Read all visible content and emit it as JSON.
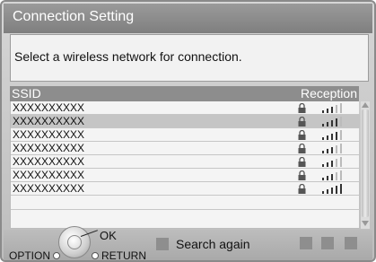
{
  "dialog": {
    "title": "Connection Setting",
    "message": "Select a wireless network for connection."
  },
  "list": {
    "columns": {
      "ssid": "SSID",
      "reception": "Reception"
    },
    "rows": [
      {
        "ssid": "XXXXXXXXXX",
        "locked": true,
        "signal_bars": 3,
        "selected": false
      },
      {
        "ssid": "XXXXXXXXXX",
        "locked": true,
        "signal_bars": 4,
        "selected": true
      },
      {
        "ssid": "XXXXXXXXXX",
        "locked": true,
        "signal_bars": 4,
        "selected": false
      },
      {
        "ssid": "XXXXXXXXXX",
        "locked": true,
        "signal_bars": 3,
        "selected": false
      },
      {
        "ssid": "XXXXXXXXXX",
        "locked": true,
        "signal_bars": 3,
        "selected": false
      },
      {
        "ssid": "XXXXXXXXXX",
        "locked": true,
        "signal_bars": 3,
        "selected": false
      },
      {
        "ssid": "XXXXXXXXXX",
        "locked": true,
        "signal_bars": 5,
        "selected": false
      }
    ]
  },
  "footer": {
    "ok_label": "OK",
    "option_label": "OPTION",
    "return_label": "RETURN",
    "search_again_label": "Search again"
  },
  "colors": {
    "title_bar": "#8b8b8b",
    "header_bar": "#8d8d8d",
    "selected_row": "#c5c5c5"
  }
}
